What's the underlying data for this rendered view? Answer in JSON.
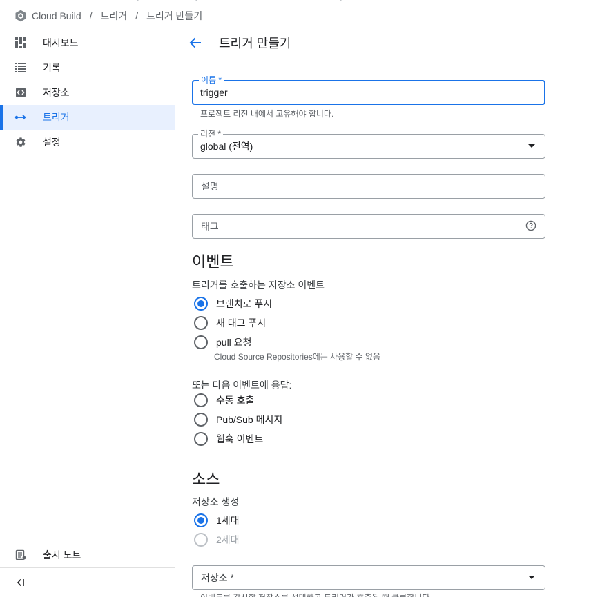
{
  "breadcrumb": {
    "app": "Cloud Build",
    "section": "트리거",
    "page": "트리거 만들기"
  },
  "sidebar": {
    "items": [
      {
        "label": "대시보드",
        "icon": "dashboard-icon"
      },
      {
        "label": "기록",
        "icon": "list-icon"
      },
      {
        "label": "저장소",
        "icon": "code-icon"
      },
      {
        "label": "트리거",
        "icon": "trigger-arrow-icon",
        "active": true
      },
      {
        "label": "설정",
        "icon": "gear-icon"
      }
    ],
    "release_notes": "출시 노트"
  },
  "header": {
    "title": "트리거 만들기"
  },
  "form": {
    "name": {
      "label": "이름 *",
      "value": "trigger",
      "hint": "프로젝트 리전 내에서 고유해야 합니다."
    },
    "region": {
      "label": "리전 *",
      "value": "global (전역)"
    },
    "description": {
      "placeholder": "설명"
    },
    "tags": {
      "placeholder": "태그"
    },
    "event": {
      "heading": "이벤트",
      "subheading": "트리거를 호출하는 저장소 이벤트",
      "options": [
        {
          "label": "브랜치로 푸시",
          "checked": true
        },
        {
          "label": "새 태그 푸시",
          "checked": false
        },
        {
          "label": "pull 요청",
          "checked": false,
          "note": "Cloud Source Repositories에는 사용할 수 없음"
        }
      ],
      "alt_subheading": "또는 다음 이벤트에 응답:",
      "alt_options": [
        {
          "label": "수동 호출"
        },
        {
          "label": "Pub/Sub 메시지"
        },
        {
          "label": "웹훅 이벤트"
        }
      ]
    },
    "source": {
      "heading": "소스",
      "subheading": "저장소 생성",
      "generations": [
        {
          "label": "1세대",
          "checked": true
        },
        {
          "label": "2세대",
          "checked": false,
          "disabled": true
        }
      ],
      "repository": {
        "label": "저장소 *",
        "hint": "이벤트를 감시할 저장소를 선택하고 트리거가 호출될 때 클론합니다."
      }
    }
  },
  "colors": {
    "accent": "#1a73e8",
    "active_bg": "#e8f0fe"
  }
}
